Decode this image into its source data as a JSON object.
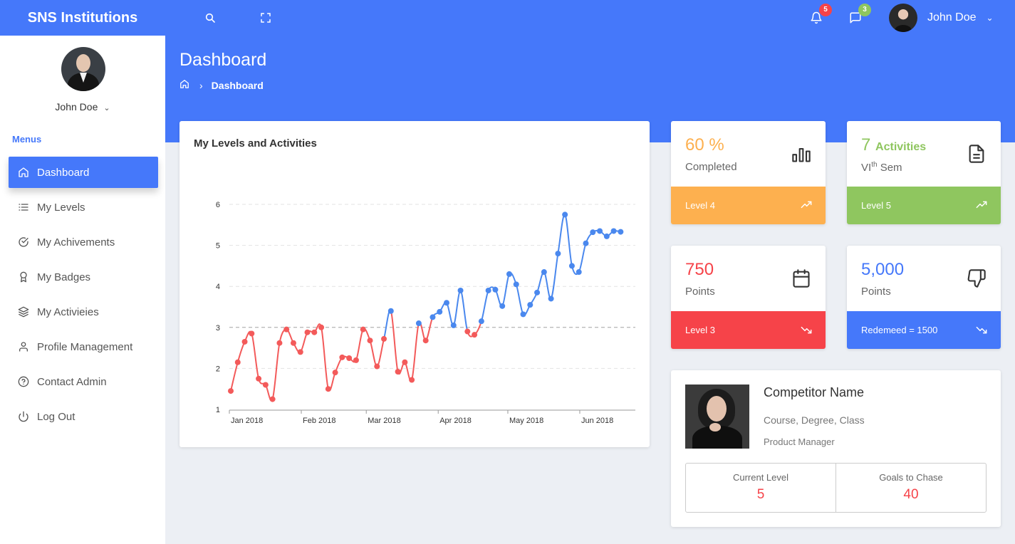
{
  "brand": "SNS Institutions",
  "topbar": {
    "notifications_count": "5",
    "messages_count": "3",
    "user_name": "John Doe"
  },
  "sidebar": {
    "user_name": "John Doe",
    "menus_label": "Menus",
    "items": [
      {
        "label": "Dashboard",
        "icon": "home-icon",
        "active": true
      },
      {
        "label": "My Levels",
        "icon": "list-icon"
      },
      {
        "label": "My Achivements",
        "icon": "check-circle-icon"
      },
      {
        "label": "My Badges",
        "icon": "award-icon"
      },
      {
        "label": "My Activieies",
        "icon": "layers-icon"
      },
      {
        "label": "Profile Management",
        "icon": "user-icon"
      },
      {
        "label": "Contact Admin",
        "icon": "help-circle-icon"
      },
      {
        "label": "Log Out",
        "icon": "power-icon"
      }
    ]
  },
  "page": {
    "title": "Dashboard",
    "breadcrumb_current": "Dashboard"
  },
  "colors": {
    "primary": "#4578fa",
    "orange": "#fdb04f",
    "green": "#8fc65f",
    "red": "#f64349",
    "series_red": "#f35a5a",
    "series_blue": "#4a88ee"
  },
  "stats": [
    {
      "value": "60 %",
      "value_suffix": "",
      "sub": "Completed",
      "sub_sup": "",
      "sub_rest": "",
      "footer": "Level 4",
      "icon": "bar-chart-icon",
      "trend": "trending-up-icon"
    },
    {
      "value": "7",
      "value_suffix": "Activities",
      "sub": "VI",
      "sub_sup": "th",
      "sub_rest": " Sem",
      "footer": "Level 5",
      "icon": "document-icon",
      "trend": "trending-up-icon"
    },
    {
      "value": "750",
      "value_suffix": "",
      "sub": "Points",
      "sub_sup": "",
      "sub_rest": "",
      "footer": "Level 3",
      "icon": "calendar-icon",
      "trend": "trending-down-icon"
    },
    {
      "value": "5,000",
      "value_suffix": "",
      "sub": "Points",
      "sub_sup": "",
      "sub_rest": "",
      "footer": "Redemeed = 1500",
      "icon": "thumbs-down-icon",
      "trend": "trending-down-icon"
    }
  ],
  "competitor": {
    "name": "Competitor Name",
    "course": "Course, Degree, Class",
    "role": "Product Manager",
    "current_level_label": "Current Level",
    "current_level": "5",
    "goals_label": "Goals to Chase",
    "goals": "40"
  },
  "chart_data": {
    "type": "line",
    "title": "My Levels and Activities",
    "xlabel": "",
    "ylabel": "",
    "ylim": [
      1,
      6
    ],
    "yticks": [
      "1",
      "2",
      "3",
      "4",
      "5",
      "6"
    ],
    "xticks": [
      "Jan 2018",
      "Feb 2018",
      "Mar 2018",
      "Apr 2018",
      "May 2018",
      "Jun 2018"
    ],
    "grid": true,
    "threshold": 3,
    "series_note_colors": [
      "below 3 red",
      "above 3 blue"
    ],
    "x": [
      "2018-01-01",
      "2018-01-04",
      "2018-01-07",
      "2018-01-10",
      "2018-01-13",
      "2018-01-16",
      "2018-01-19",
      "2018-01-22",
      "2018-01-25",
      "2018-01-28",
      "2018-01-31",
      "2018-02-03",
      "2018-02-06",
      "2018-02-09",
      "2018-02-12",
      "2018-02-15",
      "2018-02-18",
      "2018-02-21",
      "2018-02-24",
      "2018-02-27",
      "2018-03-02",
      "2018-03-05",
      "2018-03-08",
      "2018-03-11",
      "2018-03-14",
      "2018-03-17",
      "2018-03-20",
      "2018-03-23",
      "2018-03-26",
      "2018-03-29",
      "2018-04-01",
      "2018-04-04",
      "2018-04-07",
      "2018-04-10",
      "2018-04-13",
      "2018-04-16",
      "2018-04-19",
      "2018-04-22",
      "2018-04-25",
      "2018-04-28",
      "2018-05-01",
      "2018-05-04",
      "2018-05-07",
      "2018-05-10",
      "2018-05-13",
      "2018-05-16",
      "2018-05-19",
      "2018-05-22",
      "2018-05-25",
      "2018-05-28",
      "2018-05-31",
      "2018-06-03",
      "2018-06-06",
      "2018-06-09",
      "2018-06-12",
      "2018-06-15",
      "2018-06-18"
    ],
    "values": [
      1.45,
      2.15,
      2.65,
      2.85,
      1.75,
      1.6,
      1.25,
      2.62,
      2.95,
      2.62,
      2.4,
      2.88,
      2.88,
      3.0,
      1.5,
      1.9,
      2.27,
      2.25,
      2.2,
      2.95,
      2.68,
      2.05,
      2.72,
      3.4,
      1.92,
      2.15,
      1.72,
      3.1,
      2.68,
      3.25,
      3.38,
      3.6,
      3.05,
      3.9,
      2.9,
      2.82,
      3.15,
      3.9,
      3.92,
      3.52,
      4.3,
      4.05,
      3.32,
      3.55,
      3.85,
      4.35,
      3.7,
      4.8,
      5.75,
      4.5,
      4.35,
      5.05,
      5.32,
      5.35,
      5.22,
      5.35,
      5.33
    ]
  }
}
